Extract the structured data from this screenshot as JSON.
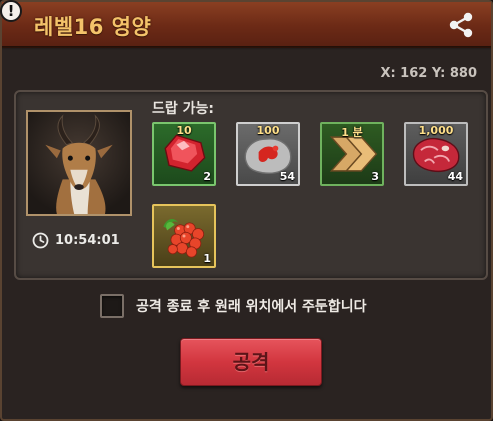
{
  "header": {
    "info_badge": "!",
    "title": "레벨16 영양",
    "share_icon": "share-icon"
  },
  "coords": "X: 162 Y: 880",
  "monster": {
    "portrait_icon": "antelope-portrait",
    "timer_icon": "clock-icon",
    "timer": "10:54:01"
  },
  "drops": {
    "label": "드랍 가능:",
    "items": [
      {
        "icon": "ruby-gem-icon",
        "top_label": "10",
        "qty": "2",
        "rarity": "green"
      },
      {
        "icon": "red-ore-stone-icon",
        "top_label": "100",
        "qty": "54",
        "rarity": "white"
      },
      {
        "icon": "speedup-chevrons-icon",
        "top_label": "1 분",
        "qty": "3",
        "rarity": "green2"
      },
      {
        "icon": "meat-icon",
        "top_label": "1,000",
        "qty": "44",
        "rarity": "grey"
      },
      {
        "icon": "raspberry-icon",
        "top_label": "",
        "qty": "1",
        "rarity": "gold"
      }
    ]
  },
  "return_option": {
    "label": "공격 종료 후 원래 위치에서 주둔합니다",
    "checked": false
  },
  "attack_button": {
    "label": "공격"
  },
  "colors": {
    "title": "#f4c36a",
    "header": "#6c2a16",
    "attack_button": "#d2363f"
  }
}
